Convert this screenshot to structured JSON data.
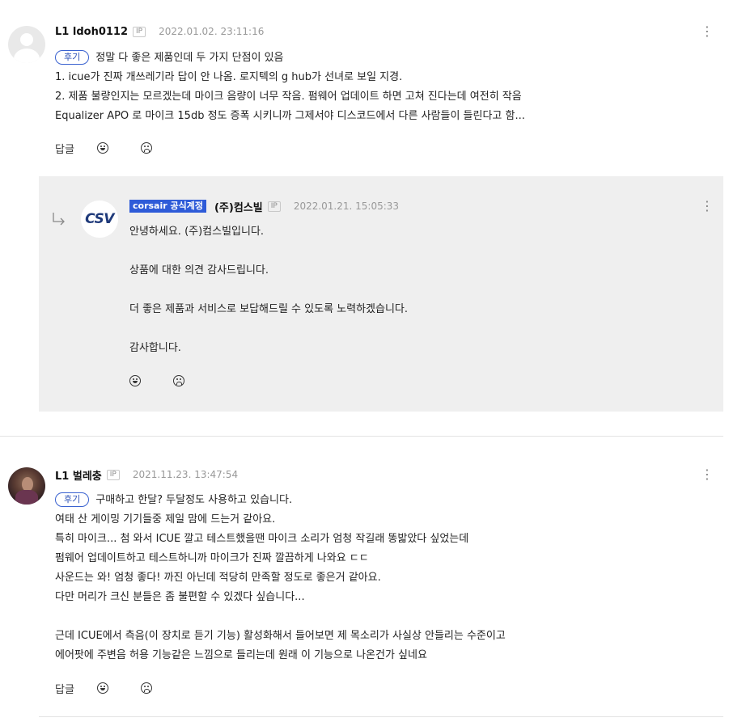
{
  "comments": [
    {
      "level": "L1",
      "author": "ldoh0112",
      "ip_label": "IP",
      "date": "2022.01.02. 23:11:16",
      "tag": "후기",
      "lines": [
        "정말 다 좋은 제품인데 두 가지 단점이 있음",
        "1. icue가 진짜 개쓰레기라 답이 안 나옴. 로지텍의 g hub가 선녀로 보일 지경.",
        "2. 제품 불량인지는 모르겠는데 마이크 음량이 너무 작음. 펌웨어 업데이트 하면 고쳐 진다는데 여전히 작음",
        "Equalizer APO 로 마이크 15db 정도 증폭 시키니까 그제서야 디스코드에서 다른 사람들이 들린다고 함..."
      ],
      "reply_label": "답글",
      "more_icon": "⋮"
    },
    {
      "level": "L1",
      "author": "벌레충",
      "ip_label": "IP",
      "date": "2021.11.23. 13:47:54",
      "tag": "후기",
      "lines": [
        "구매하고 한달? 두달정도 사용하고 있습니다.",
        "여태 산 게이밍 기기들중 제일 맘에 드는거 같아요.",
        "특히 마이크... 첨 와서 ICUE 깔고 테스트했을땐 마이크 소리가 엄청 작길래 똥밟았다 싶었는데",
        "펌웨어 업데이트하고 테스트하니까 마이크가 진짜 깔끔하게 나와요 ㄷㄷ",
        "사운드는 와! 엄청 좋다! 까진 아닌데 적당히 만족할 정도로 좋은거 같아요.",
        "다만 머리가 크신 분들은 좀 불편할 수 있겠다 싶습니다...",
        "",
        "근데 ICUE에서 측음(이 장치로 듣기 기능) 활성화해서 들어보면 제 목소리가 사실상 안들리는 수준이고",
        "에어팟에 주변음 허용 기능같은 느낌으로 들리는데 원래 이 기능으로 나온건가 싶네요"
      ],
      "reply_label": "답글",
      "more_icon": "⋮"
    }
  ],
  "official_reply": {
    "badge": "corsair 공식계정",
    "author": "(주)컴스빌",
    "ip_label": "IP",
    "date": "2022.01.21. 15:05:33",
    "logo_text": "CSV",
    "lines": [
      "안녕하세요. (주)컴스빌입니다.",
      "",
      "상품에 대한 의견 감사드립니다.",
      "",
      "더 좋은 제품과 서비스로 보답해드릴 수 있도록 노력하겠습니다.",
      "",
      "감사합니다."
    ],
    "more_icon": "⋮"
  },
  "icons": {
    "like": "smile-icon",
    "dislike": "frown-icon",
    "reply_arrow": "reply-arrow-icon",
    "more": "more-vertical-icon",
    "default_avatar": "default-avatar-icon"
  },
  "colors": {
    "tag_blue": "#2a4fb6",
    "official_badge": "#2e5bd8",
    "reply_background": "#efefef",
    "date_gray": "#999999"
  }
}
